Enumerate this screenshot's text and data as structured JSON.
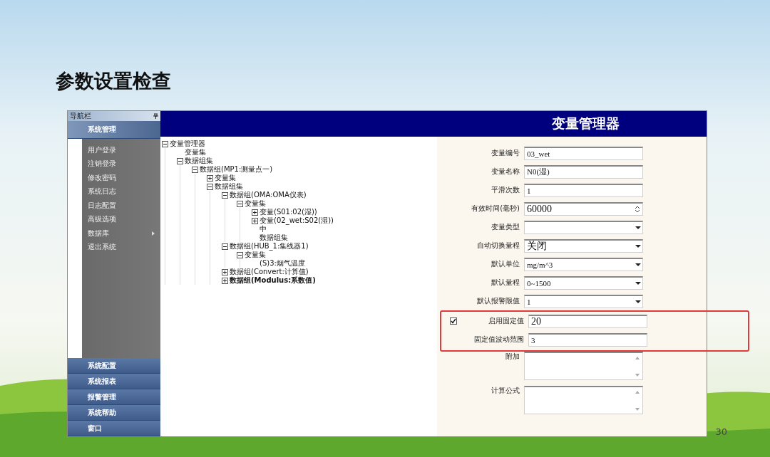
{
  "slide_title": "参数设置检查",
  "sidebar": {
    "title": "导航栏",
    "sections": [
      {
        "label": "系统管理",
        "expanded": true,
        "items": [
          {
            "label": "用户登录",
            "has_submenu": false
          },
          {
            "label": "注销登录",
            "has_submenu": false
          },
          {
            "label": "修改密码",
            "has_submenu": false
          },
          {
            "label": "系统日志",
            "has_submenu": false
          },
          {
            "label": "日志配置",
            "has_submenu": false
          },
          {
            "label": "高级选项",
            "has_submenu": false
          },
          {
            "label": "数据库",
            "has_submenu": true
          },
          {
            "label": "退出系统",
            "has_submenu": false
          }
        ]
      },
      {
        "label": "系统配置",
        "expanded": false
      },
      {
        "label": "系统报表",
        "expanded": false
      },
      {
        "label": "报警管理",
        "expanded": false
      },
      {
        "label": "系统帮助",
        "expanded": false
      },
      {
        "label": "窗口",
        "expanded": false
      }
    ]
  },
  "header": {
    "title": "变量管理器"
  },
  "tree": [
    {
      "label": "变量管理器",
      "expanded": true,
      "children": [
        {
          "label": "变量集"
        },
        {
          "label": "数据组集",
          "expanded": true,
          "children": [
            {
              "label": "数据组(MP1:测量点一)",
              "expanded": true,
              "children": [
                {
                  "label": "变量集",
                  "expanded": false
                },
                {
                  "label": "数据组集",
                  "expanded": true,
                  "children": [
                    {
                      "label": "数据组(OMA:OMA仪表)",
                      "expanded": true,
                      "children": [
                        {
                          "label": "变量集",
                          "expanded": true,
                          "children": [
                            {
                              "label": "变量(S01:02(湿))",
                              "expanded": false
                            },
                            {
                              "label": "变量(02_wet:S02(湿))",
                              "expanded": false
                            },
                            {
                              "label": "中"
                            },
                            {
                              "label": "数据组集"
                            }
                          ]
                        }
                      ]
                    },
                    {
                      "label": "数据组(HUB_1:集线器1)",
                      "expanded": true,
                      "children": [
                        {
                          "label": "变量集",
                          "expanded": true,
                          "children": [
                            {
                              "label": "(S)3:烟气温度"
                            }
                          ]
                        }
                      ]
                    },
                    {
                      "label": "数据组(Convert:计算值)",
                      "expanded": false
                    },
                    {
                      "label": "数据组(Modulus:系数值)",
                      "expanded": false,
                      "bold": true
                    }
                  ]
                }
              ]
            }
          ]
        }
      ]
    }
  ],
  "form": [
    {
      "kind": "text",
      "label": "变量编号",
      "value": "03_wet",
      "highlighted": false
    },
    {
      "kind": "text",
      "label": "变量名称",
      "value": "N0(湿)",
      "highlighted": false
    },
    {
      "kind": "text",
      "label": "平滑次数",
      "value": "1",
      "highlighted": false
    },
    {
      "kind": "spin",
      "label": "有效时间(毫秒)",
      "value": "60000",
      "highlighted": false
    },
    {
      "kind": "select",
      "label": "变量类型",
      "highlighted": false
    },
    {
      "kind": "select",
      "label": "自动切换量程",
      "value": "关闭",
      "highlighted": false
    },
    {
      "kind": "select",
      "label": "默认单位",
      "value": "mg/m^3",
      "highlighted": false
    },
    {
      "kind": "select",
      "label": "默认量程",
      "value": "0~1500",
      "highlighted": false
    },
    {
      "kind": "select",
      "label": "默认报警限值",
      "value": "1",
      "highlighted": false
    },
    {
      "kind": "checkbox",
      "label": "启用固定值",
      "checked": true,
      "value": "20",
      "highlighted": true
    },
    {
      "kind": "text",
      "label": "固定值波动范围",
      "value": "3",
      "highlighted": true
    },
    {
      "kind": "textarea",
      "label": "附加",
      "highlighted": false
    },
    {
      "kind": "textarea",
      "label": "计算公式",
      "highlighted": false
    }
  ],
  "page_number": "30"
}
